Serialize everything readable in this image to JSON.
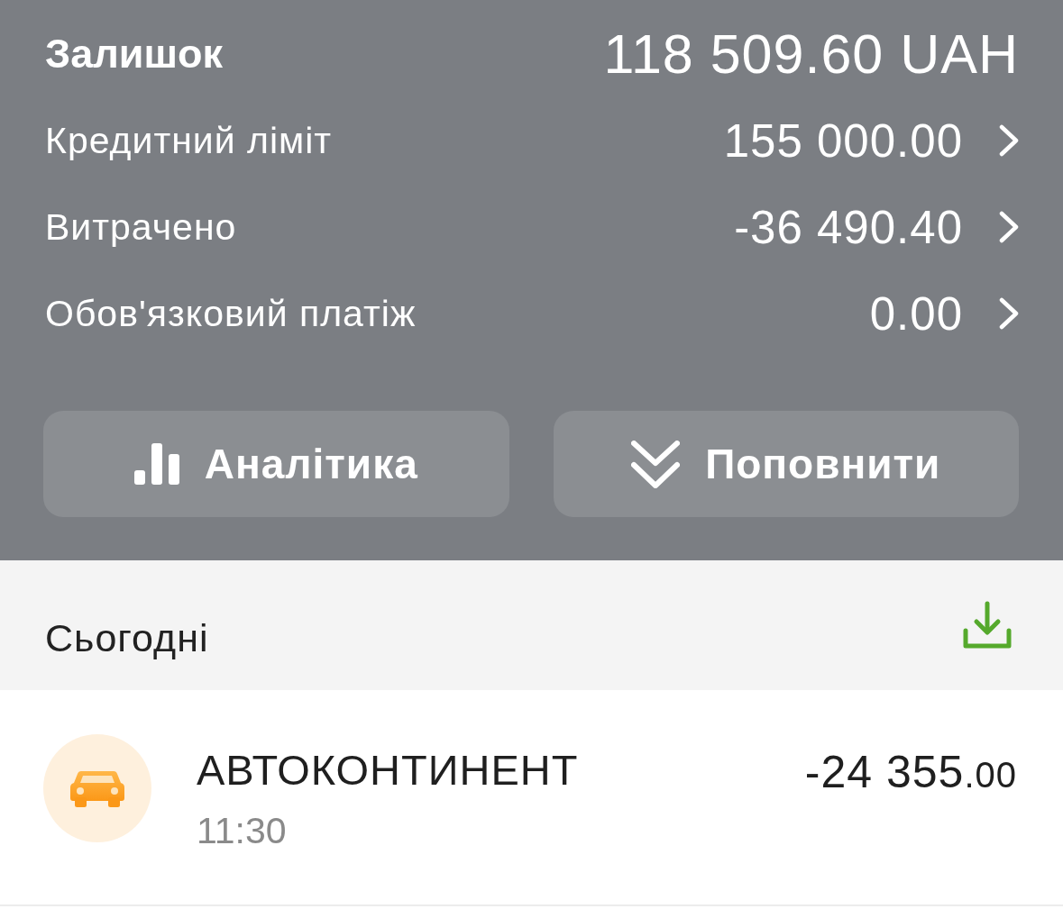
{
  "balance": {
    "label": "Залишок",
    "amount": "118 509.60 UAH"
  },
  "details": [
    {
      "label": "Кредитний ліміт",
      "value": "155 000.00"
    },
    {
      "label": "Витрачено",
      "value": "-36 490.40"
    },
    {
      "label": "Обов'язковий платіж",
      "value": "0.00"
    }
  ],
  "actions": [
    {
      "kind": "analytics",
      "label": "Аналітика"
    },
    {
      "kind": "topup",
      "label": "Поповнити"
    }
  ],
  "section": {
    "title": "Сьогодні"
  },
  "transactions": [
    {
      "kind": "car",
      "title": "АВТОКОНТИНЕНТ",
      "time": "11:30",
      "amount": {
        "whole": "-24 355",
        "fraction": ".00"
      }
    }
  ]
}
